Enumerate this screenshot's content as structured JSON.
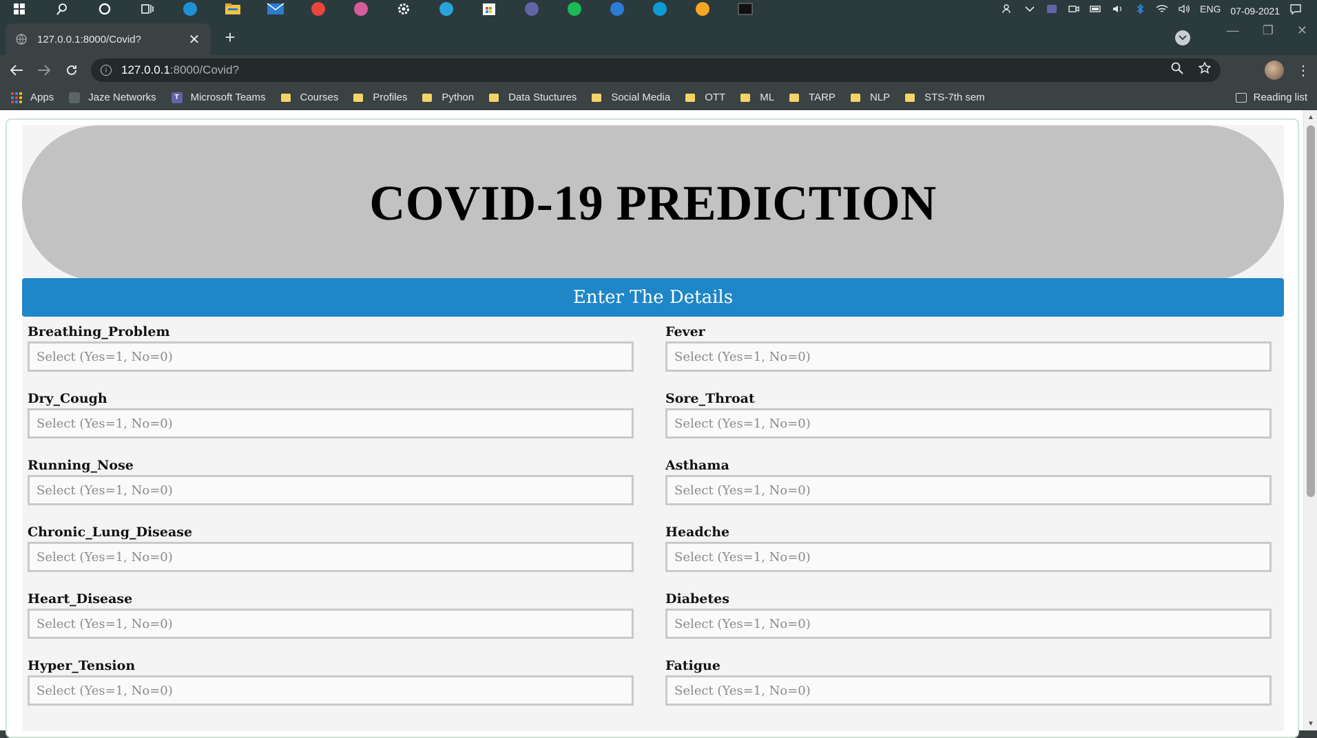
{
  "taskbar": {
    "icons": [
      "windows-start-icon",
      "search-icon",
      "cortana-icon",
      "task-view-icon",
      "edge-icon",
      "file-explorer-icon",
      "mail-icon",
      "chrome-icon",
      "snip-icon",
      "settings-icon",
      "telegram-icon",
      "store-icon",
      "teams-icon",
      "spotify-icon",
      "todo-icon",
      "skype-icon",
      "weather-icon",
      "terminal-icon"
    ],
    "tray": {
      "language": "ENG",
      "date": "07-09-2021"
    }
  },
  "browser": {
    "tab_title": "127.0.0.1:8000/Covid?",
    "new_tab": "+",
    "url_host": "127.0.0.1",
    "url_path": ":8000/Covid?",
    "bookmarks": [
      {
        "label": "Apps",
        "kind": "apps"
      },
      {
        "label": "Jaze Networks",
        "kind": "globe"
      },
      {
        "label": "Microsoft Teams",
        "kind": "teams"
      },
      {
        "label": "Courses",
        "kind": "folder"
      },
      {
        "label": "Profiles",
        "kind": "folder"
      },
      {
        "label": "Python",
        "kind": "folder"
      },
      {
        "label": "Data Stuctures",
        "kind": "folder"
      },
      {
        "label": "Social Media",
        "kind": "folder"
      },
      {
        "label": "OTT",
        "kind": "folder"
      },
      {
        "label": "ML",
        "kind": "folder"
      },
      {
        "label": "TARP",
        "kind": "folder"
      },
      {
        "label": "NLP",
        "kind": "folder"
      },
      {
        "label": "STS-7th sem",
        "kind": "folder"
      }
    ],
    "reading_list": "Reading list"
  },
  "page": {
    "title": "COVID-19 PREDICTION",
    "section_header": "Enter The Details",
    "select_placeholder": "Select (Yes=1, No=0)",
    "fields_left": [
      "Breathing_Problem",
      "Dry_Cough",
      "Running_Nose",
      "Chronic_Lung_Disease",
      "Heart_Disease",
      "Hyper_Tension"
    ],
    "fields_right": [
      "Fever",
      "Sore_Throat",
      "Asthama",
      "Headche",
      "Diabetes",
      "Fatigue"
    ]
  }
}
